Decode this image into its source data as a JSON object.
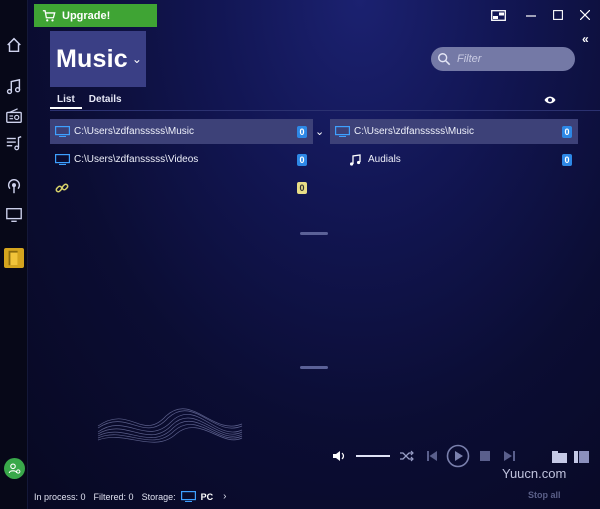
{
  "titlebar": {
    "upgrade_label": "Upgrade!",
    "buttons": [
      "mini-player-icon",
      "minimize-icon",
      "maximize-icon",
      "close-icon"
    ]
  },
  "sidebar": {
    "items": [
      {
        "icon": "home-icon"
      },
      {
        "icon": "music-note-icon"
      },
      {
        "icon": "radio-icon"
      },
      {
        "icon": "playlist-icon"
      },
      {
        "icon": "podcast-icon"
      },
      {
        "icon": "monitor-icon"
      },
      {
        "icon": "storage-icon",
        "active": true
      }
    ]
  },
  "header": {
    "title": "Music",
    "filter_placeholder": "Filter"
  },
  "tabs": [
    {
      "label": "List",
      "active": true
    },
    {
      "label": "Details",
      "active": false
    }
  ],
  "left_panel": {
    "rows": [
      {
        "label": "C:\\Users\\zdfansssss\\Music",
        "count": "0",
        "icon": "pc-icon",
        "selected": true
      },
      {
        "label": "C:\\Users\\zdfansssss\\Videos",
        "count": "0",
        "icon": "pc-icon",
        "selected": false
      },
      {
        "label": "",
        "count": "0",
        "icon": "link-icon",
        "selected": false
      }
    ]
  },
  "right_panel": {
    "rows": [
      {
        "label": "C:\\Users\\zdfansssss\\Music",
        "count": "0",
        "icon": "pc-icon",
        "selected": true
      },
      {
        "label": "Audials",
        "count": "0",
        "icon": "music-note-icon",
        "selected": false
      }
    ]
  },
  "status": {
    "in_process": "In process: 0",
    "filtered": "Filtered: 0",
    "storage_label": "Storage:",
    "storage_value": "PC",
    "stop_all": "Stop all"
  },
  "watermark": "Yuucn.com",
  "colors": {
    "upgrade_green": "#3fa434",
    "badge_blue": "#2d88e6",
    "badge_yellow": "#e8dd86",
    "selected_row": "#3d4178",
    "active_rail": "#d4a41e"
  }
}
